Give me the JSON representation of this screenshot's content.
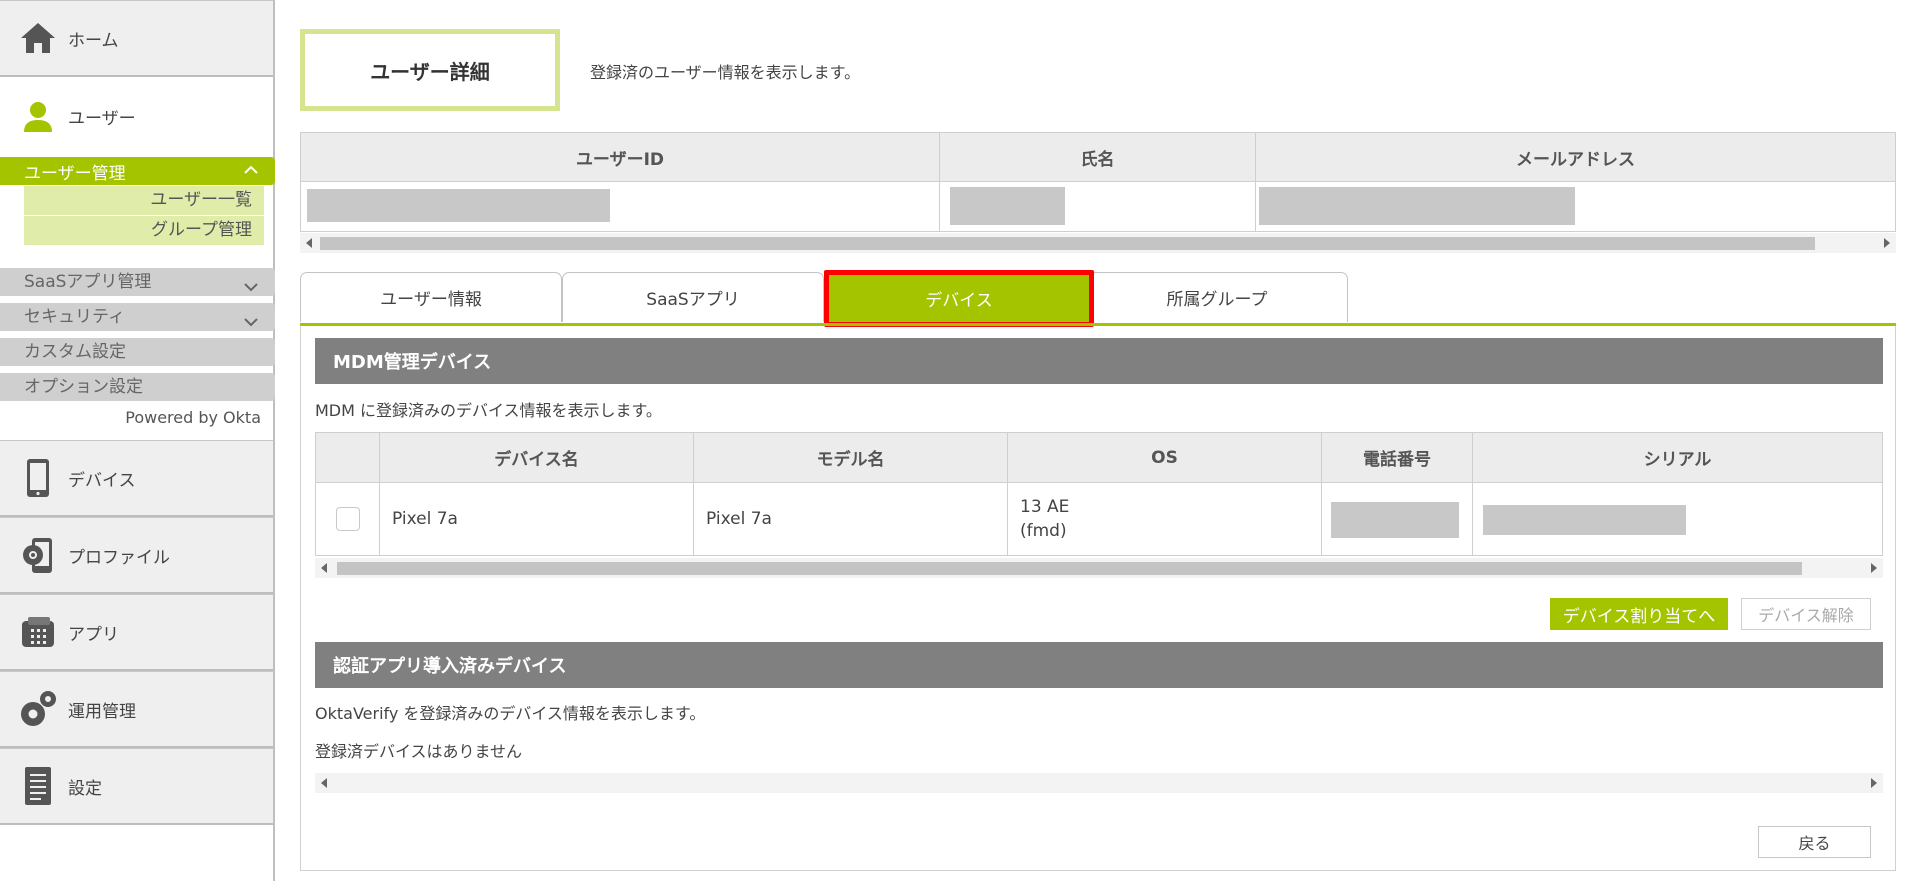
{
  "sidebar": {
    "home_label": "ホーム",
    "user_label": "ユーザー",
    "user_mgmt_label": "ユーザー管理",
    "user_list_label": "ユーザー一覧",
    "group_mgmt_label": "グループ管理",
    "saas_mgmt_label": "SaaSアプリ管理",
    "security_label": "セキュリティ",
    "custom_label": "カスタム設定",
    "option_label": "オプション設定",
    "powered_by": "Powered by Okta",
    "device_label": "デバイス",
    "profile_label": "プロファイル",
    "app_label": "アプリ",
    "ops_label": "運用管理",
    "settings_label": "設定",
    "accent_color": "#a4c400"
  },
  "page": {
    "title": "ユーザー詳細",
    "description": "登録済のユーザー情報を表示します。"
  },
  "user_table": {
    "headers": [
      "ユーザーID",
      "氏名",
      "メールアドレス"
    ]
  },
  "tabs": [
    {
      "label": "ユーザー情報"
    },
    {
      "label": "SaaSアプリ"
    },
    {
      "label": "デバイス"
    },
    {
      "label": "所属グループ"
    }
  ],
  "mdm": {
    "header": "MDM管理デバイス",
    "description": "MDM に登録済みのデバイス情報を表示します。",
    "columns": [
      "デバイス名",
      "モデル名",
      "OS",
      "電話番号",
      "シリアル"
    ],
    "rows": [
      {
        "device_name": "Pixel 7a",
        "model": "Pixel 7a",
        "os_line1": "13 AE",
        "os_line2": "(fmd)"
      }
    ],
    "assign_button": "デバイス割り当てへ",
    "release_button": "デバイス解除"
  },
  "auth_app": {
    "header": "認証アプリ導入済みデバイス",
    "description": "OktaVerify を登録済みのデバイス情報を表示します。",
    "empty_message": "登録済デバイスはありません"
  },
  "back_button": "戻る"
}
